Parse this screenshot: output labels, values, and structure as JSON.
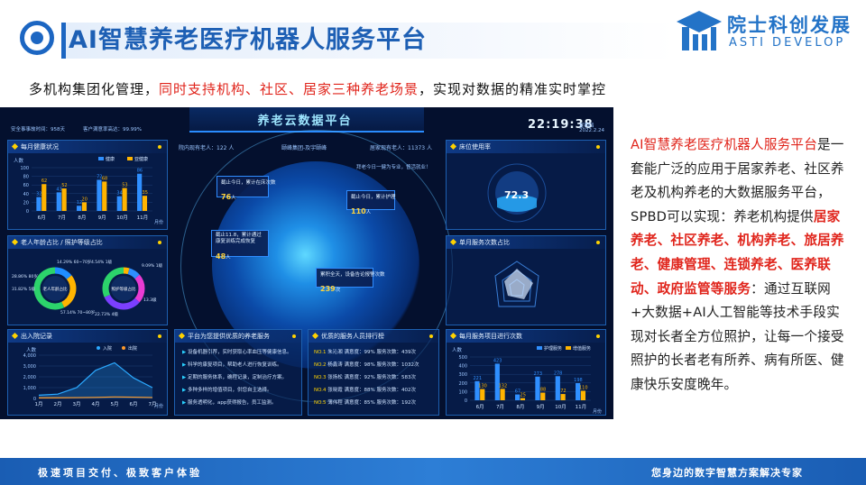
{
  "header": {
    "title": "AI智慧养老医疗机器人服务平台",
    "brand_cn": "院士科创发展",
    "brand_en": "ASTI DEVELOP"
  },
  "subtitle": {
    "part1": "多机构集团化管理，",
    "part2": "同时支持机构、社区、居家三种养老场景",
    "part3": "，实现对数据的精准实时掌控"
  },
  "dashboard": {
    "title": "养老云数据平台",
    "top_left_a": "安全事事故时间：958天",
    "top_left_b": "客户满意率高达：99.99%",
    "clock": "22:19:38",
    "date_a": "星期四",
    "date_b": "2022.2.24",
    "center_left": "院内现有老人：122 人",
    "center_mid": "颐峰集团-及宇颐峰",
    "center_right": "居家现有老人：11373 人",
    "globe_hint": "拜老今日一健为专业，督活就业！",
    "panels": {
      "monthly": "每月健康状况",
      "age": "老人年龄占比 / 照护等级占比",
      "inout": "出入院记录",
      "services": "平台为您提供优质的养老服务",
      "ranking": "优质的服务人员排行榜",
      "bed": "床位使用率",
      "single": "单月服务次数占比",
      "monthly_services": "每月服务项目进行次数"
    },
    "info_boxes": [
      {
        "label": "截止今日，累计在床次数",
        "value": "76",
        "unit": "人"
      },
      {
        "label": "截止11.8，累计通过康复训练完成恢复",
        "value": "48",
        "unit": "人"
      },
      {
        "label": "截止今日，累计护理",
        "value": "110",
        "unit": "人"
      },
      {
        "label": "累积全天，设备告论报警次数",
        "value": "239",
        "unit": "次"
      }
    ],
    "bed_rate": "72.3",
    "legend": {
      "health": "健康",
      "sub_health": "亚健康",
      "in": "入院",
      "out": "出院",
      "care": "护理服务",
      "value_added": "增值服务"
    },
    "axis": {
      "people": "人数",
      "month": "月份"
    },
    "donut1": {
      "center": "老人年龄占比",
      "labels": [
        "14.29% 60~70岁",
        "28.86% 80岁",
        "31.82% 5级",
        "57.14% 70~80岁"
      ]
    },
    "donut2": {
      "center": "照护等级占比",
      "labels": [
        "4.54% 1级",
        "9.09% 1级",
        "22.73% 4级",
        "13.3级"
      ]
    },
    "service_items": [
      "设备机器引荐，实时获取心率血压等健康信息。",
      "科学的康复项目，帮助老人进行恢复训练。",
      "定期的服务体系，确程记录，定制治疗方案。",
      "多种多样的增值项目，供您自主选择。",
      "服务透明化，app获得报告，员工监测。"
    ],
    "ranking_rows": [
      {
        "no": "NO.1",
        "name": "朱沁湘",
        "sat": "满意度：99%",
        "count": "服务次数：439次"
      },
      {
        "no": "NO.2",
        "name": "杨鑫涛",
        "sat": "满意度：98%",
        "count": "服务次数：1032次"
      },
      {
        "no": "NO.3",
        "name": "张扬松",
        "sat": "满意度：92%",
        "count": "服务次数：583次"
      },
      {
        "no": "NO.4",
        "name": "张晓霞",
        "sat": "满意度：88%",
        "count": "服务次数：402次"
      },
      {
        "no": "NO.5",
        "name": "薄伟程",
        "sat": "满意度：85%",
        "count": "服务次数：192次"
      }
    ]
  },
  "chart_data": [
    {
      "type": "bar",
      "title": "每月健康状况",
      "categories": [
        "6月",
        "7月",
        "8月",
        "9月",
        "10月",
        "11月"
      ],
      "series": [
        {
          "name": "健康",
          "values": [
            32,
            43,
            12,
            72,
            34,
            86
          ]
        },
        {
          "name": "亚健康",
          "values": [
            62,
            52,
            20,
            68,
            53,
            35
          ]
        }
      ],
      "ylabel": "人数",
      "xlabel": "月份",
      "ylim": [
        0,
        100
      ],
      "yticks": [
        0,
        20,
        40,
        60,
        80,
        100
      ]
    },
    {
      "type": "line",
      "title": "出入院记录",
      "categories": [
        "1月",
        "2月",
        "3月",
        "4月",
        "5月",
        "6月",
        "7月"
      ],
      "series": [
        {
          "name": "入院",
          "values": [
            300,
            400,
            1000,
            2600,
            3300,
            1900,
            1000
          ]
        },
        {
          "name": "出院",
          "values": [
            50,
            60,
            80,
            100,
            140,
            120,
            90
          ]
        }
      ],
      "ylabel": "人数",
      "xlabel": "月份",
      "ylim": [
        0,
        4000
      ],
      "yticks": [
        0,
        1000,
        2000,
        3000,
        4000
      ]
    },
    {
      "type": "bar",
      "title": "每月服务项目进行次数",
      "categories": [
        "6月",
        "7月",
        "8月",
        "9月",
        "10月",
        "11月"
      ],
      "series": [
        {
          "name": "护理服务",
          "values": [
            221,
            423,
            67,
            273,
            278,
            198
          ]
        },
        {
          "name": "增值服务",
          "values": [
            130,
            132,
            25,
            88,
            72,
            110
          ]
        }
      ],
      "ylabel": "人数",
      "xlabel": "月份",
      "ylim": [
        0,
        500
      ],
      "yticks": [
        0,
        100,
        200,
        300,
        400,
        500
      ]
    },
    {
      "type": "pie",
      "title": "老人年龄占比",
      "values": [
        14.29,
        28.57,
        57.14
      ]
    },
    {
      "type": "pie",
      "title": "照护等级占比",
      "values": [
        4.54,
        9.09,
        22.73,
        31.82,
        31.82
      ]
    }
  ],
  "side": {
    "p1": "AI智慧养老医疗机器人服务平台",
    "p2": "是一套能广泛的应用于居家养老、社区养老及机构养老的大数据服务平台，SPBD可以实现：养老机构提供",
    "p3": "居家养老、社区养老、机构养老、旅居养老、健康管理、连锁养老、医养联动、政府监管等服务",
    "p4": "：通过互联网+大数据+AI人工智能等技术手段实现对长者全方位照护，让每一个接受照护的长者老有所养、病有所医、健康快乐安度晚年。"
  },
  "footer": {
    "left": "极速项目交付、极致客户体验",
    "right": "您身边的数字智慧方案解决专家"
  },
  "colors": {
    "brand_blue": "#1d5fb4",
    "accent_red": "#e0241b",
    "health_blue": "#2f8fff",
    "sub_health_yellow": "#ffb400"
  }
}
